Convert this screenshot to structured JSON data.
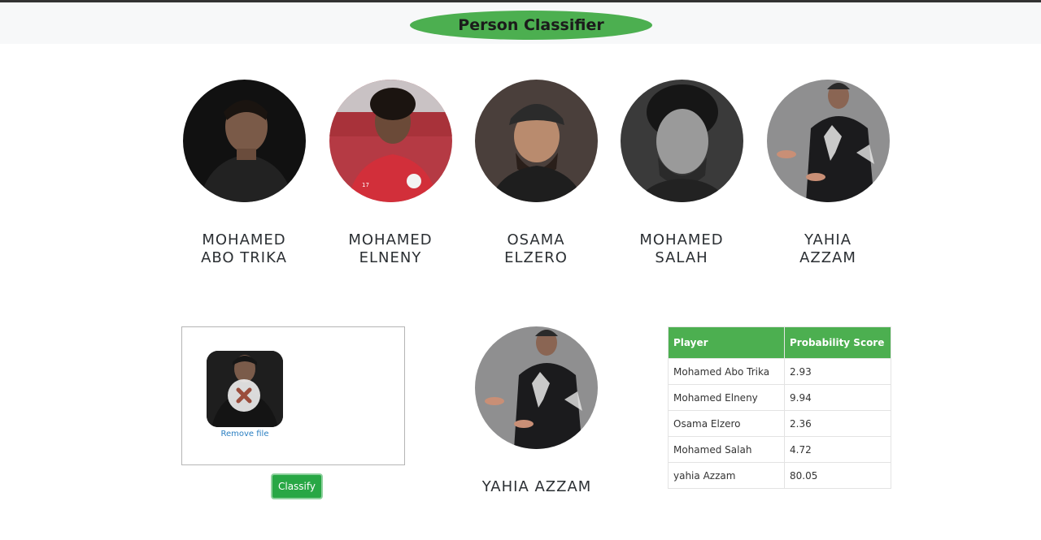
{
  "header": {
    "title": "Person Classifier"
  },
  "people": [
    {
      "name_line1": "MOHAMED",
      "name_line2": "ABO TRIKA"
    },
    {
      "name_line1": "MOHAMED",
      "name_line2": "ELNENY"
    },
    {
      "name_line1": "OSAMA",
      "name_line2": "ELZERO"
    },
    {
      "name_line1": "MOHAMED",
      "name_line2": "SALAH"
    },
    {
      "name_line1": "YAHIA",
      "name_line2": "AZZAM"
    }
  ],
  "upload": {
    "remove_label": "Remove file"
  },
  "classify_button": "Classify",
  "result": {
    "name": "YAHIA AZZAM"
  },
  "scores": {
    "headers": [
      "Player",
      "Probability Score"
    ],
    "rows": [
      {
        "player": "Mohamed Abo Trika",
        "score": "2.93"
      },
      {
        "player": "Mohamed Elneny",
        "score": "9.94"
      },
      {
        "player": "Osama Elzero",
        "score": "2.36"
      },
      {
        "player": "Mohamed Salah",
        "score": "4.72"
      },
      {
        "player": "yahia Azzam",
        "score": "80.05"
      }
    ]
  },
  "colors": {
    "accent": "#4caf50",
    "button": "#28a745",
    "link": "#2a7fc2"
  }
}
